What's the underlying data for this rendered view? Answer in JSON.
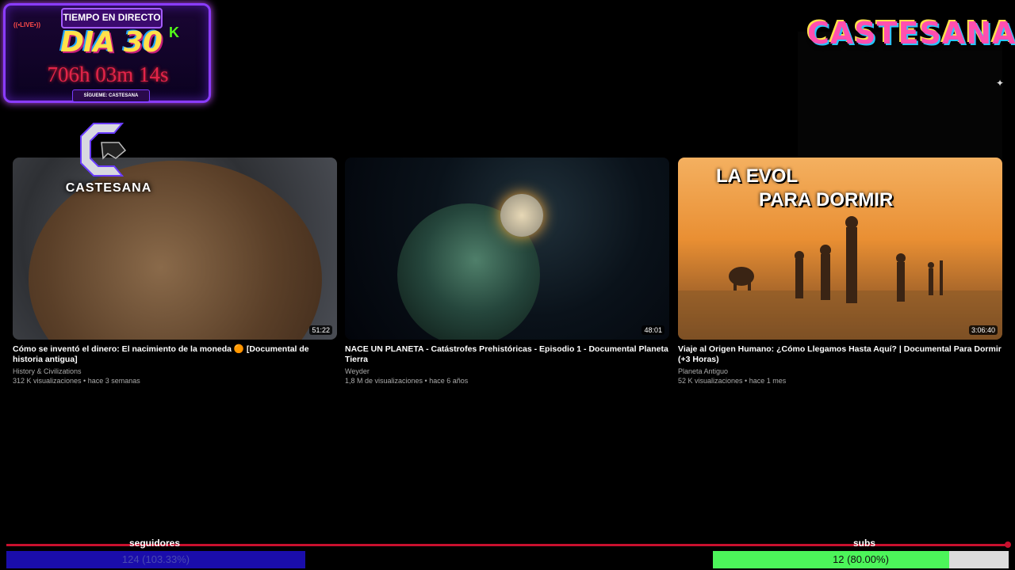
{
  "live_overlay": {
    "header": "TIEMPO EN DIRECTO",
    "badge": "((•LIVE•))",
    "day": "DIA 30",
    "timer": "706h 03m 14s",
    "follow": "SÍGUEME: CASTESANA",
    "kick_icon": "K"
  },
  "brand": {
    "top_logo": "CASTESANA",
    "side_logo": "CASTESANA"
  },
  "videos": [
    {
      "title": "Cómo se inventó el dinero: El nacimiento de la moneda 🟠 [Documental de historia antigua]",
      "channel": "History & Civilizations",
      "meta": "312 K visualizaciones • hace 3 semanas",
      "duration": "51:22"
    },
    {
      "title": "NACE UN PLANETA - Catástrofes Prehistóricas - Episodio 1 - Documental Planeta Tierra",
      "channel": "Weyder",
      "meta": "1,8 M de visualizaciones • hace 6 años",
      "duration": "48:01"
    },
    {
      "title": "Viaje al Origen Humano: ¿Cómo Llegamos Hasta Aquí? | Documental Para Dormir (+3 Horas)",
      "channel": "Planeta Antiguo",
      "meta": "52 K visualizaciones • hace 1 mes",
      "duration": "3:06:40",
      "overlay_line1": "LA EVOL",
      "overlay_line2": "PARA DORMIR"
    }
  ],
  "goals": {
    "followers": {
      "label": "seguidores",
      "text": "124 (103.33%)",
      "progress": 1.0,
      "color": "#1a0dab"
    },
    "subs": {
      "label": "subs",
      "text": "12 (80.00%)",
      "progress": 0.8,
      "color": "#4cf55a"
    }
  }
}
